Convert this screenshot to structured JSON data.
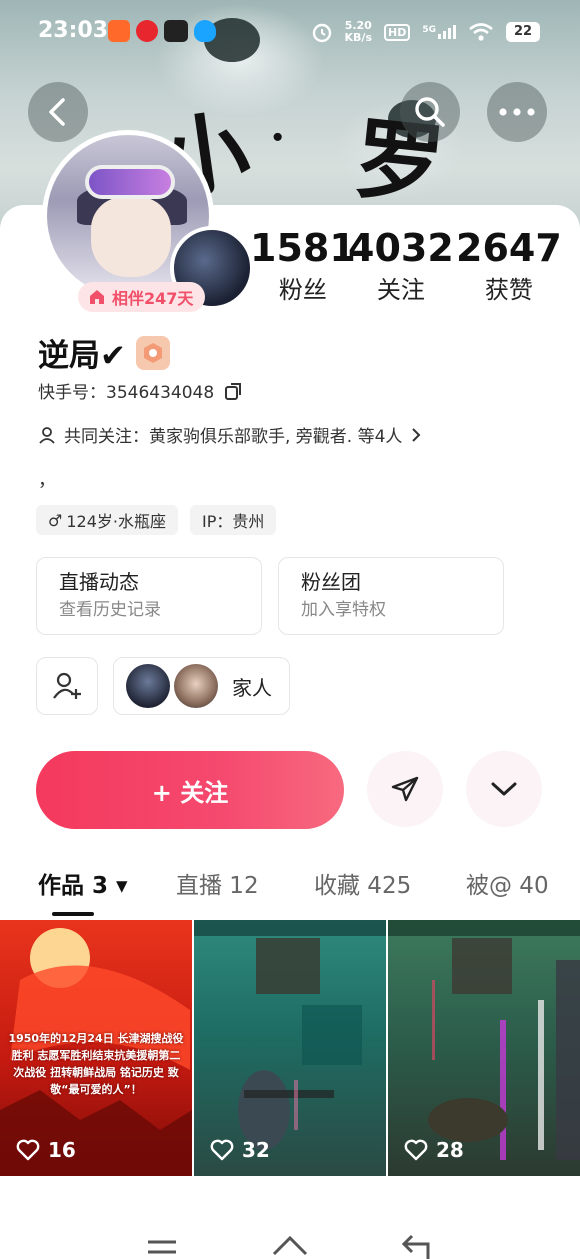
{
  "status_bar": {
    "time": "23:03",
    "speed_value": "5.20",
    "speed_unit": "KB/s",
    "battery": "22",
    "hd": "HD",
    "net": "5G"
  },
  "hero_text": {
    "char1": "小",
    "char2": "罗"
  },
  "profile": {
    "companion_label": "相伴247天",
    "name": "逆局✔",
    "kuaishou_id": "快手号：3546434048",
    "mutual_follow": "共同关注：黄家驹俱乐部歌手, 旁觀者. 等4人",
    "bio": "，",
    "tag_age": "124岁·水瓶座",
    "tag_ip": "IP：贵州"
  },
  "stats": [
    {
      "value": "1581",
      "label": "粉丝"
    },
    {
      "value": "4032",
      "label": "关注"
    },
    {
      "value": "2647",
      "label": "获赞"
    }
  ],
  "features": {
    "live": {
      "title": "直播动态",
      "subtitle": "查看历史记录"
    },
    "fans": {
      "title": "粉丝团",
      "subtitle": "加入享特权"
    }
  },
  "family_label": "家人",
  "follow_button": "+ 关注",
  "tabs": [
    {
      "label": "作品 3 ▾"
    },
    {
      "label": "直播 12"
    },
    {
      "label": "收藏 425"
    },
    {
      "label": "被@ 40"
    }
  ],
  "videos": [
    {
      "likes": "16",
      "caption": "1950年的12月24日  长津湖搜战役胜利 志愿军胜利结束抗美援朝第二次战役 扭转朝鲜战局 铭记历史 致敬“最可爱的人”！"
    },
    {
      "likes": "32"
    },
    {
      "likes": "28"
    }
  ],
  "colors": {
    "accent": "#f5496e",
    "companion_text": "#f0506a"
  }
}
